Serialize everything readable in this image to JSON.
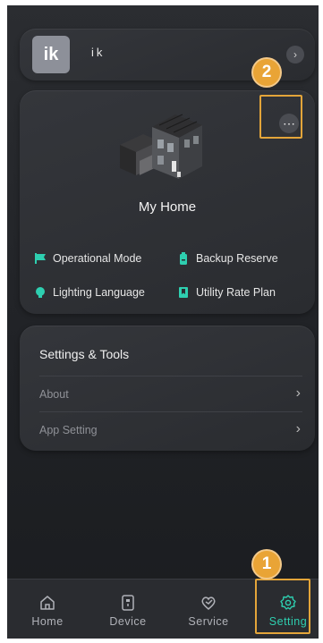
{
  "user": {
    "avatar_text": "ik",
    "name": "ik"
  },
  "home": {
    "title": "My Home",
    "features": [
      {
        "label": "Operational Mode",
        "icon": "flag-icon"
      },
      {
        "label": "Backup Reserve",
        "icon": "battery-icon"
      },
      {
        "label": "Lighting Language",
        "icon": "lightbulb-icon"
      },
      {
        "label": "Utility Rate Plan",
        "icon": "bookmark-icon"
      }
    ]
  },
  "settings": {
    "title": "Settings & Tools",
    "rows": [
      {
        "label": "About"
      },
      {
        "label": "App Setting"
      }
    ]
  },
  "annotations": {
    "step1": "1",
    "step2": "2"
  },
  "nav": {
    "items": [
      {
        "label": "Home",
        "icon": "home-icon"
      },
      {
        "label": "Device",
        "icon": "device-icon"
      },
      {
        "label": "Service",
        "icon": "service-icon"
      },
      {
        "label": "Setting",
        "icon": "gear-icon"
      }
    ],
    "active": "Setting"
  },
  "colors": {
    "accent": "#2ecfb0",
    "highlight": "#e3a53a",
    "badge": "#e9a436",
    "background": "#222428"
  }
}
